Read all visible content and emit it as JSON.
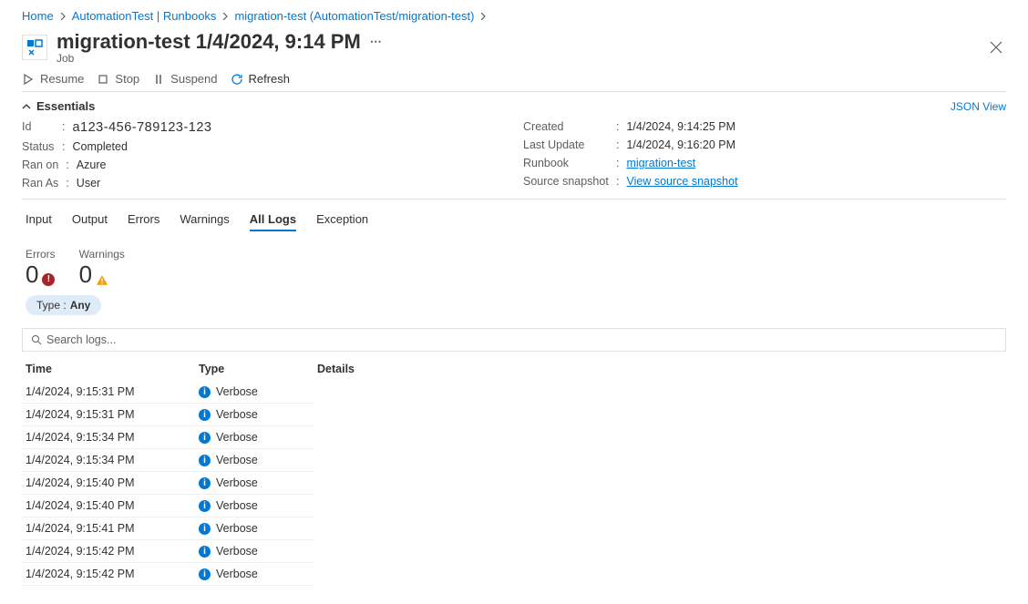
{
  "breadcrumb": {
    "home": "Home",
    "l1": "AutomationTest | Runbooks",
    "l2": "migration-test (AutomationTest/migration-test)"
  },
  "header": {
    "title": "migration-test 1/4/2024, 9:14 PM",
    "subtitle": "Job"
  },
  "toolbar": {
    "resume": "Resume",
    "stop": "Stop",
    "suspend": "Suspend",
    "refresh": "Refresh"
  },
  "essentials": {
    "label": "Essentials",
    "json_view": "JSON View",
    "left": {
      "id_k": "Id",
      "id_v": "a123-456-789123-123",
      "status_k": "Status",
      "status_v": "Completed",
      "ranon_k": "Ran on",
      "ranon_v": "Azure",
      "ranas_k": "Ran As",
      "ranas_v": "User"
    },
    "right": {
      "created_k": "Created",
      "created_v": "1/4/2024, 9:14:25 PM",
      "lastupdate_k": "Last Update",
      "lastupdate_v": "1/4/2024, 9:16:20 PM",
      "runbook_k": "Runbook",
      "runbook_v": "migration-test",
      "snapshot_k": "Source snapshot",
      "snapshot_v": "View source snapshot"
    }
  },
  "tabs": {
    "input": "Input",
    "output": "Output",
    "errors": "Errors",
    "warnings": "Warnings",
    "all_logs": "All Logs",
    "exception": "Exception"
  },
  "counters": {
    "errors_label": "Errors",
    "errors_value": "0",
    "warnings_label": "Warnings",
    "warnings_value": "0"
  },
  "filter": {
    "key": "Type : ",
    "value": "Any"
  },
  "search": {
    "placeholder": "Search logs..."
  },
  "log_table": {
    "headers": {
      "time": "Time",
      "type": "Type",
      "details": "Details"
    },
    "rows": [
      {
        "time": "1/4/2024, 9:15:31 PM",
        "type": "Verbose",
        "details": ""
      },
      {
        "time": "1/4/2024, 9:15:31 PM",
        "type": "Verbose",
        "details": ""
      },
      {
        "time": "1/4/2024, 9:15:34 PM",
        "type": "Verbose",
        "details": ""
      },
      {
        "time": "1/4/2024, 9:15:34 PM",
        "type": "Verbose",
        "details": ""
      },
      {
        "time": "1/4/2024, 9:15:40 PM",
        "type": "Verbose",
        "details": ""
      },
      {
        "time": "1/4/2024, 9:15:40 PM",
        "type": "Verbose",
        "details": ""
      },
      {
        "time": "1/4/2024, 9:15:41 PM",
        "type": "Verbose",
        "details": ""
      },
      {
        "time": "1/4/2024, 9:15:42 PM",
        "type": "Verbose",
        "details": ""
      },
      {
        "time": "1/4/2024, 9:15:42 PM",
        "type": "Verbose",
        "details": ""
      }
    ]
  }
}
